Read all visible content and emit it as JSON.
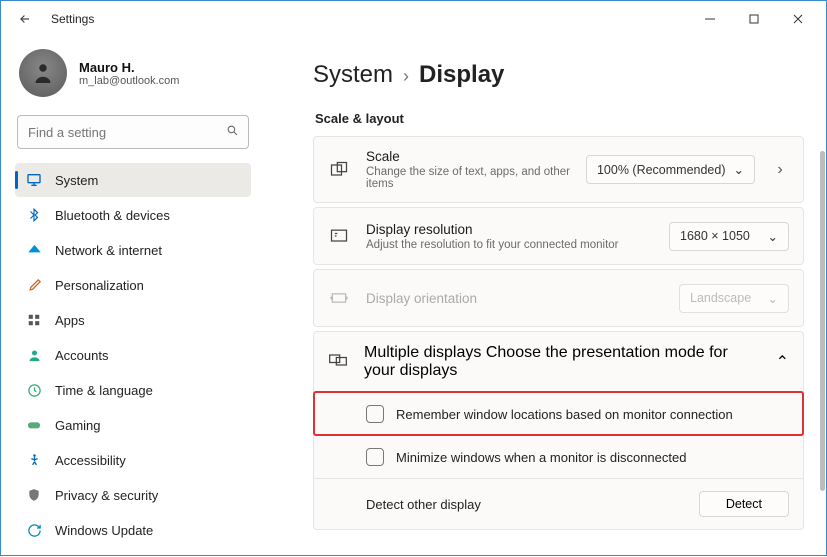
{
  "window": {
    "title": "Settings"
  },
  "profile": {
    "name": "Mauro H.",
    "email": "m_lab@outlook.com"
  },
  "search": {
    "placeholder": "Find a setting"
  },
  "nav": {
    "items": [
      {
        "label": "System"
      },
      {
        "label": "Bluetooth & devices"
      },
      {
        "label": "Network & internet"
      },
      {
        "label": "Personalization"
      },
      {
        "label": "Apps"
      },
      {
        "label": "Accounts"
      },
      {
        "label": "Time & language"
      },
      {
        "label": "Gaming"
      },
      {
        "label": "Accessibility"
      },
      {
        "label": "Privacy & security"
      },
      {
        "label": "Windows Update"
      }
    ]
  },
  "breadcrumb": {
    "parent": "System",
    "current": "Display"
  },
  "section": {
    "scale_layout": "Scale & layout"
  },
  "cards": {
    "scale": {
      "title": "Scale",
      "sub": "Change the size of text, apps, and other items",
      "value": "100% (Recommended)"
    },
    "resolution": {
      "title": "Display resolution",
      "sub": "Adjust the resolution to fit your connected monitor",
      "value": "1680 × 1050"
    },
    "orientation": {
      "title": "Display orientation",
      "value": "Landscape"
    },
    "multi": {
      "title": "Multiple displays",
      "sub": "Choose the presentation mode for your displays"
    }
  },
  "multi_rows": {
    "remember": "Remember window locations based on monitor connection",
    "minimize": "Minimize windows when a monitor is disconnected",
    "detect_label": "Detect other display",
    "detect_btn": "Detect"
  }
}
